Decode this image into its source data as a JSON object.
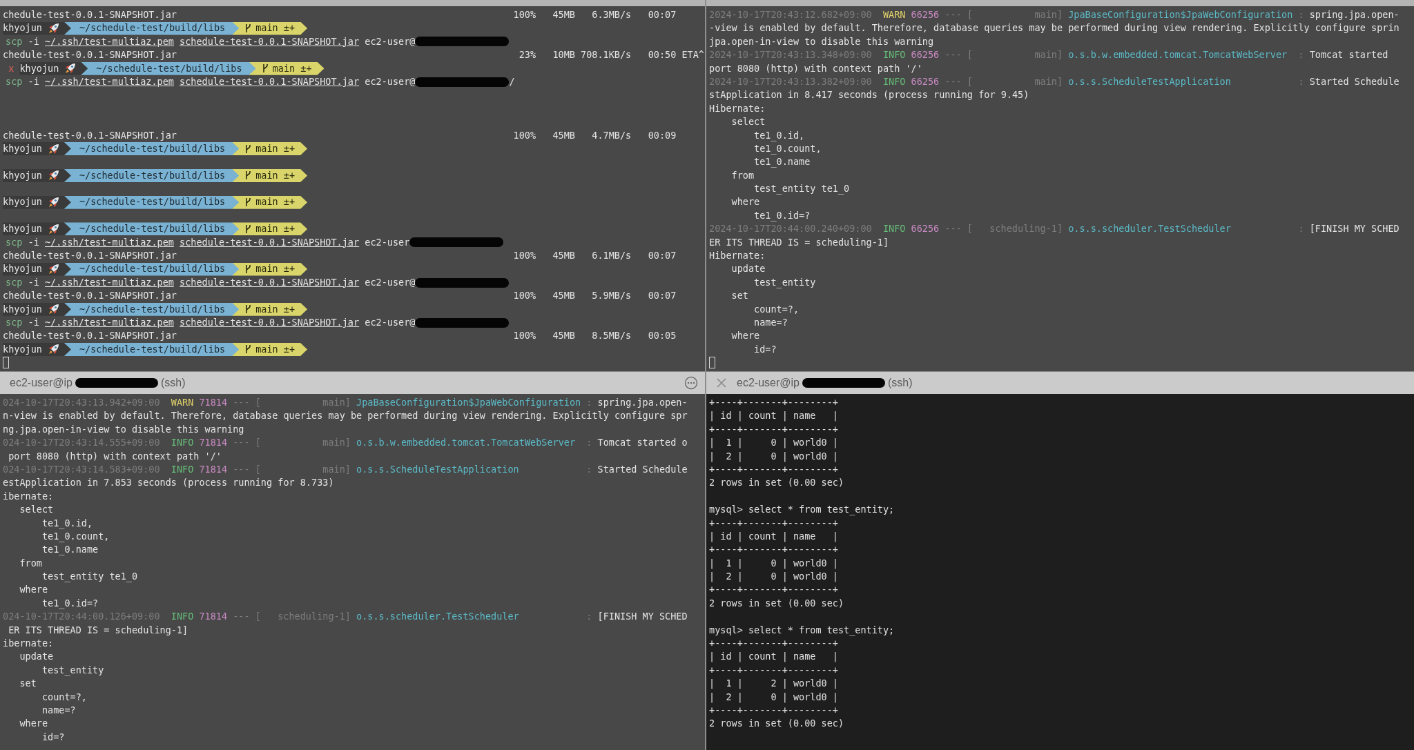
{
  "panes": [
    {
      "kind": "gray",
      "header": {
        "kind": "strip"
      },
      "lines": [
        {
          "kind": "progress",
          "file": "chedule-test-0.0.1-SNAPSHOT.jar",
          "percent": "100%",
          "size": "45MB",
          "rate": "6.3MB/s",
          "time": "00:07"
        },
        {
          "kind": "prompt",
          "user": "khyojun",
          "path": "~/schedule-test/build/libs",
          "branch": "main ±+"
        },
        {
          "kind": "segments",
          "segments": [
            {
              "kind": "command",
              "text": "scp"
            },
            {
              "kind": "plain",
              "text": "-i"
            },
            {
              "kind": "file",
              "text": "~/.ssh/test-multiaz.pem"
            },
            {
              "kind": "file",
              "text": "schedule-test-0.0.1-SNAPSHOT.jar"
            },
            {
              "kind": "host",
              "text": "ec2-user@"
            },
            {
              "kind": "redacted"
            }
          ]
        },
        {
          "kind": "progress",
          "file": "chedule-test-0.0.1-SNAPSHOT.jar",
          "percent": "23%",
          "size": "10MB",
          "rate": "708.1KB/s",
          "time": "00:50 ETA^"
        },
        {
          "kind": "prompt",
          "error_mark": "x",
          "user": "khyojun",
          "path": "~/schedule-test/build/libs",
          "branch": "main ±+"
        },
        {
          "kind": "segments",
          "segments": [
            {
              "kind": "command",
              "text": "scp"
            },
            {
              "kind": "plain",
              "text": "-i"
            },
            {
              "kind": "file",
              "text": "~/.ssh/test-multiaz.pem"
            },
            {
              "kind": "file",
              "text": "schedule-test-0.0.1-SNAPSHOT.jar"
            },
            {
              "kind": "host",
              "text": "ec2-user@"
            },
            {
              "kind": "redacted"
            },
            {
              "kind": "host",
              "text": "/"
            }
          ]
        },
        {
          "kind": "blank"
        },
        {
          "kind": "blank"
        },
        {
          "kind": "blank"
        },
        {
          "kind": "progress",
          "file": "chedule-test-0.0.1-SNAPSHOT.jar",
          "percent": "100%",
          "size": "45MB",
          "rate": "4.7MB/s",
          "time": "00:09"
        },
        {
          "kind": "prompt",
          "user": "khyojun",
          "path": "~/schedule-test/build/libs",
          "branch": "main ±+"
        },
        {
          "kind": "blank"
        },
        {
          "kind": "prompt",
          "user": "khyojun",
          "path": "~/schedule-test/build/libs",
          "branch": "main ±+"
        },
        {
          "kind": "blank"
        },
        {
          "kind": "prompt",
          "user": "khyojun",
          "path": "~/schedule-test/build/libs",
          "branch": "main ±+"
        },
        {
          "kind": "blank"
        },
        {
          "kind": "prompt",
          "user": "khyojun",
          "path": "~/schedule-test/build/libs",
          "branch": "main ±+"
        },
        {
          "kind": "segments",
          "segments": [
            {
              "kind": "command",
              "text": "scp"
            },
            {
              "kind": "plain",
              "text": "-i"
            },
            {
              "kind": "file",
              "text": "~/.ssh/test-multiaz.pem"
            },
            {
              "kind": "file",
              "text": "schedule-test-0.0.1-SNAPSHOT.jar"
            },
            {
              "kind": "host",
              "text": "ec2-user"
            },
            {
              "kind": "redacted"
            }
          ]
        },
        {
          "kind": "progress",
          "file": "chedule-test-0.0.1-SNAPSHOT.jar",
          "percent": "100%",
          "size": "45MB",
          "rate": "6.1MB/s",
          "time": "00:07"
        },
        {
          "kind": "prompt",
          "user": "khyojun",
          "path": "~/schedule-test/build/libs",
          "branch": "main ±+"
        },
        {
          "kind": "segments",
          "segments": [
            {
              "kind": "command",
              "text": "scp"
            },
            {
              "kind": "plain",
              "text": "-i"
            },
            {
              "kind": "file",
              "text": "~/.ssh/test-multiaz.pem"
            },
            {
              "kind": "file",
              "text": "schedule-test-0.0.1-SNAPSHOT.jar"
            },
            {
              "kind": "host",
              "text": "ec2-user@"
            },
            {
              "kind": "redacted"
            }
          ]
        },
        {
          "kind": "progress",
          "file": "chedule-test-0.0.1-SNAPSHOT.jar",
          "percent": "100%",
          "size": "45MB",
          "rate": "5.9MB/s",
          "time": "00:07"
        },
        {
          "kind": "prompt",
          "user": "khyojun",
          "path": "~/schedule-test/build/libs",
          "branch": "main ±+"
        },
        {
          "kind": "segments",
          "segments": [
            {
              "kind": "command",
              "text": "scp"
            },
            {
              "kind": "plain",
              "text": "-i"
            },
            {
              "kind": "file",
              "text": "~/.ssh/test-multiaz.pem"
            },
            {
              "kind": "file",
              "text": "schedule-test-0.0.1-SNAPSHOT.jar"
            },
            {
              "kind": "host",
              "text": "ec2-user@"
            },
            {
              "kind": "redacted"
            }
          ]
        },
        {
          "kind": "progress",
          "file": "chedule-test-0.0.1-SNAPSHOT.jar",
          "percent": "100%",
          "size": "45MB",
          "rate": "8.5MB/s",
          "time": "00:05"
        },
        {
          "kind": "prompt",
          "user": "khyojun",
          "path": "~/schedule-test/build/libs",
          "branch": "main ±+"
        },
        {
          "kind": "cursor"
        }
      ]
    },
    {
      "kind": "gray",
      "header": {
        "kind": "strip"
      },
      "lines": [
        {
          "kind": "segments",
          "segments": [
            {
              "kind": "timestamp",
              "text": "2024-10-17T20:43:12.682+09:00"
            },
            {
              "kind": "warn",
              "text": "WARN"
            },
            {
              "kind": "pid",
              "text": "66256"
            },
            {
              "kind": "separator",
              "text": "--- ["
            },
            {
              "kind": "thread",
              "text": "main"
            },
            {
              "kind": "bracket",
              "text": "]"
            },
            {
              "kind": "logger",
              "text": "JpaBaseConfiguration$JpaWebConfiguration"
            },
            {
              "kind": "colon",
              "text": ":"
            },
            {
              "kind": "message",
              "text": "spring.jpa.open-"
            }
          ]
        },
        {
          "kind": "text",
          "text": "-view is enabled by default. Therefore, database queries may be performed during view rendering. Explicitly configure sprin"
        },
        {
          "kind": "text",
          "text": "jpa.open-in-view to disable this warning"
        },
        {
          "kind": "segments",
          "segments": [
            {
              "kind": "timestamp",
              "text": "2024-10-17T20:43:13.348+09:00"
            },
            {
              "kind": "info",
              "text": "INFO"
            },
            {
              "kind": "pid",
              "text": "66256"
            },
            {
              "kind": "separator",
              "text": "--- ["
            },
            {
              "kind": "thread",
              "text": "main"
            },
            {
              "kind": "bracket",
              "text": "]"
            },
            {
              "kind": "logger",
              "text": "o.s.b.w.embedded.tomcat.TomcatWebServer"
            },
            {
              "kind": "colon",
              "text": ":"
            },
            {
              "kind": "message",
              "text": "Tomcat started"
            }
          ]
        },
        {
          "kind": "text",
          "text": "port 8080 (http) with context path '/'"
        },
        {
          "kind": "segments",
          "segments": [
            {
              "kind": "timestamp",
              "text": "2024-10-17T20:43:13.382+09:00"
            },
            {
              "kind": "info",
              "text": "INFO"
            },
            {
              "kind": "pid",
              "text": "66256"
            },
            {
              "kind": "separator",
              "text": "--- ["
            },
            {
              "kind": "thread",
              "text": "main"
            },
            {
              "kind": "bracket",
              "text": "]"
            },
            {
              "kind": "logger",
              "text": "o.s.s.ScheduleTestApplication"
            },
            {
              "kind": "colon",
              "text": ":"
            },
            {
              "kind": "message",
              "text": "Started Schedule"
            }
          ]
        },
        {
          "kind": "text",
          "text": "stApplication in 8.417 seconds (process running for 9.45)"
        },
        {
          "kind": "text",
          "text": "Hibernate:"
        },
        {
          "kind": "text",
          "text": "    select"
        },
        {
          "kind": "text",
          "text": "        te1_0.id,"
        },
        {
          "kind": "text",
          "text": "        te1_0.count,"
        },
        {
          "kind": "text",
          "text": "        te1_0.name"
        },
        {
          "kind": "text",
          "text": "    from"
        },
        {
          "kind": "text",
          "text": "        test_entity te1_0"
        },
        {
          "kind": "text",
          "text": "    where"
        },
        {
          "kind": "text",
          "text": "        te1_0.id=?"
        },
        {
          "kind": "segments",
          "segments": [
            {
              "kind": "timestamp",
              "text": "2024-10-17T20:44:00.240+09:00"
            },
            {
              "kind": "info",
              "text": "INFO"
            },
            {
              "kind": "pid",
              "text": "66256"
            },
            {
              "kind": "separator",
              "text": "--- ["
            },
            {
              "kind": "thread",
              "text": "scheduling-1"
            },
            {
              "kind": "bracket",
              "text": "]"
            },
            {
              "kind": "logger",
              "text": "o.s.s.scheduler.TestScheduler"
            },
            {
              "kind": "colon",
              "text": ":"
            },
            {
              "kind": "message",
              "text": "[FINISH MY SCHED"
            }
          ]
        },
        {
          "kind": "text",
          "text": "ER ITS THREAD IS = scheduling-1]"
        },
        {
          "kind": "text",
          "text": "Hibernate:"
        },
        {
          "kind": "text",
          "text": "    update"
        },
        {
          "kind": "text",
          "text": "        test_entity"
        },
        {
          "kind": "text",
          "text": "    set"
        },
        {
          "kind": "text",
          "text": "        count=?,"
        },
        {
          "kind": "text",
          "text": "        name=?"
        },
        {
          "kind": "text",
          "text": "    where"
        },
        {
          "kind": "text",
          "text": "        id=?"
        },
        {
          "kind": "cursor"
        }
      ]
    },
    {
      "kind": "gray",
      "header": {
        "kind": "tab",
        "closable": false,
        "menu_button": true,
        "title": "ec2-user@ip",
        "redacted": true,
        "suffix": "(ssh)"
      },
      "lines": [
        {
          "kind": "segments",
          "segments": [
            {
              "kind": "timestamp",
              "text": "024-10-17T20:43:13.942+09:00"
            },
            {
              "kind": "warn",
              "text": "WARN"
            },
            {
              "kind": "pid",
              "text": "71814"
            },
            {
              "kind": "separator",
              "text": "--- ["
            },
            {
              "kind": "thread",
              "text": "main"
            },
            {
              "kind": "bracket",
              "text": "]"
            },
            {
              "kind": "logger",
              "text": "JpaBaseConfiguration$JpaWebConfiguration"
            },
            {
              "kind": "colon",
              "text": ":"
            },
            {
              "kind": "message",
              "text": "spring.jpa.open-"
            }
          ]
        },
        {
          "kind": "text",
          "text": "n-view is enabled by default. Therefore, database queries may be performed during view rendering. Explicitly configure spr"
        },
        {
          "kind": "text",
          "text": "ng.jpa.open-in-view to disable this warning"
        },
        {
          "kind": "segments",
          "segments": [
            {
              "kind": "timestamp",
              "text": "024-10-17T20:43:14.555+09:00"
            },
            {
              "kind": "info",
              "text": "INFO"
            },
            {
              "kind": "pid",
              "text": "71814"
            },
            {
              "kind": "separator",
              "text": "--- ["
            },
            {
              "kind": "thread",
              "text": "main"
            },
            {
              "kind": "bracket",
              "text": "]"
            },
            {
              "kind": "logger",
              "text": "o.s.b.w.embedded.tomcat.TomcatWebServer"
            },
            {
              "kind": "colon",
              "text": ":"
            },
            {
              "kind": "message",
              "text": "Tomcat started o"
            }
          ]
        },
        {
          "kind": "text",
          "text": " port 8080 (http) with context path '/'"
        },
        {
          "kind": "segments",
          "segments": [
            {
              "kind": "timestamp",
              "text": "024-10-17T20:43:14.583+09:00"
            },
            {
              "kind": "info",
              "text": "INFO"
            },
            {
              "kind": "pid",
              "text": "71814"
            },
            {
              "kind": "separator",
              "text": "--- ["
            },
            {
              "kind": "thread",
              "text": "main"
            },
            {
              "kind": "bracket",
              "text": "]"
            },
            {
              "kind": "logger",
              "text": "o.s.s.ScheduleTestApplication"
            },
            {
              "kind": "colon",
              "text": ":"
            },
            {
              "kind": "message",
              "text": "Started Schedule"
            }
          ]
        },
        {
          "kind": "text",
          "text": "estApplication in 7.853 seconds (process running for 8.733)"
        },
        {
          "kind": "text",
          "text": "ibernate:"
        },
        {
          "kind": "text",
          "text": "   select"
        },
        {
          "kind": "text",
          "text": "       te1_0.id,"
        },
        {
          "kind": "text",
          "text": "       te1_0.count,"
        },
        {
          "kind": "text",
          "text": "       te1_0.name"
        },
        {
          "kind": "text",
          "text": "   from"
        },
        {
          "kind": "text",
          "text": "       test_entity te1_0"
        },
        {
          "kind": "text",
          "text": "   where"
        },
        {
          "kind": "text",
          "text": "       te1_0.id=?"
        },
        {
          "kind": "segments",
          "segments": [
            {
              "kind": "timestamp",
              "text": "024-10-17T20:44:00.126+09:00"
            },
            {
              "kind": "info",
              "text": "INFO"
            },
            {
              "kind": "pid",
              "text": "71814"
            },
            {
              "kind": "separator",
              "text": "--- ["
            },
            {
              "kind": "thread",
              "text": "scheduling-1"
            },
            {
              "kind": "bracket",
              "text": "]"
            },
            {
              "kind": "logger",
              "text": "o.s.s.scheduler.TestScheduler"
            },
            {
              "kind": "colon",
              "text": ":"
            },
            {
              "kind": "message",
              "text": "[FINISH MY SCHED"
            }
          ]
        },
        {
          "kind": "text",
          "text": " ER ITS THREAD IS = scheduling-1]"
        },
        {
          "kind": "text",
          "text": "ibernate:"
        },
        {
          "kind": "text",
          "text": "   update"
        },
        {
          "kind": "text",
          "text": "       test_entity"
        },
        {
          "kind": "text",
          "text": "   set"
        },
        {
          "kind": "text",
          "text": "       count=?,"
        },
        {
          "kind": "text",
          "text": "       name=?"
        },
        {
          "kind": "text",
          "text": "   where"
        },
        {
          "kind": "text",
          "text": "       id=?"
        }
      ]
    },
    {
      "kind": "dark",
      "header": {
        "kind": "tab",
        "closable": true,
        "menu_button": false,
        "title": "ec2-user@ip",
        "redacted": true,
        "suffix": "(ssh)"
      },
      "lines": [
        {
          "kind": "text",
          "text": "+----+-------+--------+"
        },
        {
          "kind": "text",
          "text": "| id | count | name   |"
        },
        {
          "kind": "text",
          "text": "+----+-------+--------+"
        },
        {
          "kind": "text",
          "text": "|  1 |     0 | world0 |"
        },
        {
          "kind": "text",
          "text": "|  2 |     0 | world0 |"
        },
        {
          "kind": "text",
          "text": "+----+-------+--------+"
        },
        {
          "kind": "text",
          "text": "2 rows in set (0.00 sec)"
        },
        {
          "kind": "blank"
        },
        {
          "kind": "text",
          "text": "mysql> select * from test_entity;"
        },
        {
          "kind": "text",
          "text": "+----+-------+--------+"
        },
        {
          "kind": "text",
          "text": "| id | count | name   |"
        },
        {
          "kind": "text",
          "text": "+----+-------+--------+"
        },
        {
          "kind": "text",
          "text": "|  1 |     0 | world0 |"
        },
        {
          "kind": "text",
          "text": "|  2 |     0 | world0 |"
        },
        {
          "kind": "text",
          "text": "+----+-------+--------+"
        },
        {
          "kind": "text",
          "text": "2 rows in set (0.00 sec)"
        },
        {
          "kind": "blank"
        },
        {
          "kind": "text",
          "text": "mysql> select * from test_entity;"
        },
        {
          "kind": "text",
          "text": "+----+-------+--------+"
        },
        {
          "kind": "text",
          "text": "| id | count | name   |"
        },
        {
          "kind": "text",
          "text": "+----+-------+--------+"
        },
        {
          "kind": "text",
          "text": "|  1 |     2 | world0 |"
        },
        {
          "kind": "text",
          "text": "|  2 |     0 | world0 |"
        },
        {
          "kind": "text",
          "text": "+----+-------+--------+"
        },
        {
          "kind": "text",
          "text": "2 rows in set (0.00 sec)"
        }
      ]
    }
  ]
}
